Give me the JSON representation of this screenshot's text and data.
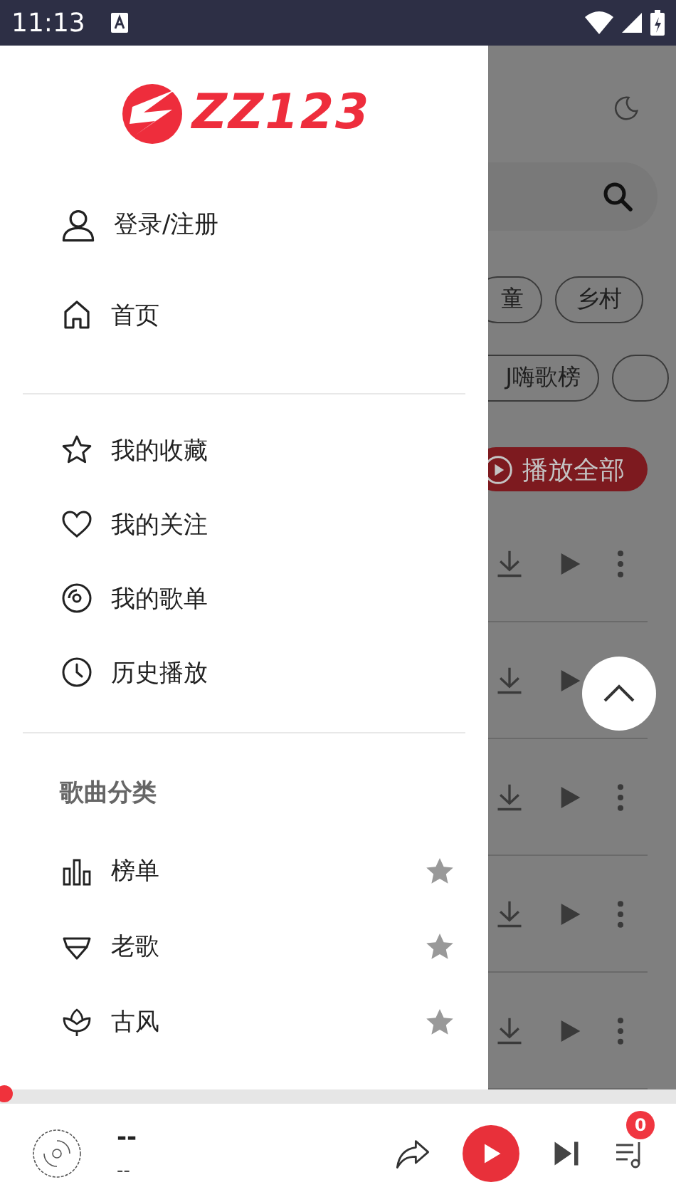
{
  "status_bar": {
    "time": "11:13"
  },
  "drawer": {
    "logo": "ZZ123",
    "login": "登录/注册",
    "main_items": [
      {
        "label": "首页",
        "kind": "home"
      }
    ],
    "my_items": [
      {
        "label": "我的收藏",
        "kind": "star"
      },
      {
        "label": "我的关注",
        "kind": "heart"
      },
      {
        "label": "我的歌单",
        "kind": "disc"
      },
      {
        "label": "历史播放",
        "kind": "clock"
      }
    ],
    "section_title": "歌曲分类",
    "categories": [
      {
        "label": "榜单",
        "kind": "chart"
      },
      {
        "label": "老歌",
        "kind": "gem"
      },
      {
        "label": "古风",
        "kind": "lotus"
      }
    ]
  },
  "behind": {
    "chips_row_1": [
      "童",
      "乡村"
    ],
    "chips_row_2": [
      "J嗨歌榜"
    ],
    "play_all": "播放全部"
  },
  "player": {
    "title": "--",
    "artist": "--",
    "queue_count": "0",
    "level": 0
  }
}
